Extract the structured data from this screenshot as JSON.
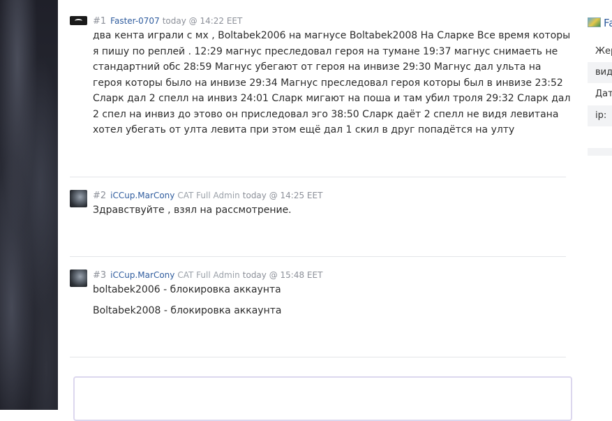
{
  "posts": [
    {
      "number": "#1",
      "author": "Faster-0707",
      "role": "",
      "date": "today @ 14:22 EET",
      "avatar_icon": "dark-mask-avatar",
      "paragraphs": [
        "два кента играли с мх , Boltabek2006 на магнусе Boltabek2008 На Сларке Все время которы я пишу по реплей . 12:29 магнус преследовал героя на тумане 19:37 магнус снимаеть не стандартний обс 28:59 Магнус убегают от героя на инвизе 29:30 Магнус дал ульта на героя которы было на инвизе 29:34 Магнус преследовал героя которы был в инвизе 23:52 Сларк дал 2 спелл на инвиз 24:01 Сларк мигают на поша и там убил троля 29:32 Сларк дал 2 спел на инвиз до этово он приследовал эго 38:50 Сларк даёт 2 спелл не видя левитана хотел убегать от улта левита при этом ещё дал 1 скил в друг попадётся на улту"
      ]
    },
    {
      "number": "#2",
      "author": "iCCup.MarCony",
      "role": "CAT Full Admin",
      "date": "today @ 14:25 EET",
      "avatar_icon": "wolf-avatar",
      "paragraphs": [
        "Здравствуйте , взял на рассмотрение."
      ]
    },
    {
      "number": "#3",
      "author": "iCCup.MarCony",
      "role": "CAT Full Admin",
      "date": "today @ 15:48 EET",
      "avatar_icon": "wolf-avatar",
      "paragraphs": [
        "boltabek2006 - блокировка аккаунта",
        "Boltabek2008 - блокировка аккаунта"
      ]
    }
  ],
  "sidebar": {
    "title": "Fa",
    "flag_icon": "country-flag-icon",
    "rows": [
      "Жер",
      "вид",
      "Дат",
      "ip:"
    ]
  },
  "reply_box": {
    "value": ""
  },
  "colors": {
    "link": "#2f5c9e",
    "meta": "#8c9099",
    "divider": "#e3e5e8",
    "reply_border": "#dcd7ee"
  }
}
